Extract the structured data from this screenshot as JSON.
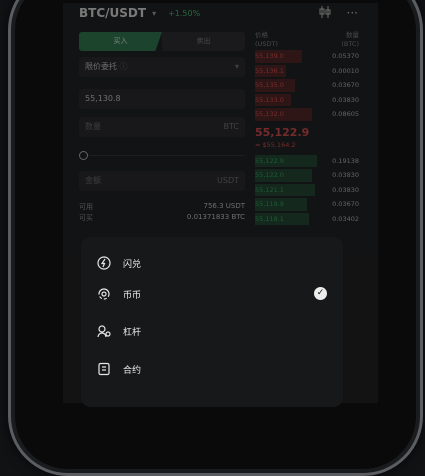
{
  "header": {
    "pair": "BTC/USDT",
    "caret": "▾",
    "change": "+1.50%",
    "icons": [
      "candlestick-icon",
      "more-icon"
    ]
  },
  "tabs": {
    "buy": "买入",
    "sell": "卖出"
  },
  "order_type": {
    "value": "限价委托",
    "hint": "ⓘ",
    "caret": "▾"
  },
  "price_input": {
    "value": "55,130.8"
  },
  "amount_input": {
    "placeholder": "数量",
    "unit": "BTC"
  },
  "total_input": {
    "placeholder": "金额",
    "unit": "USDT"
  },
  "balances": {
    "available_label": "可用",
    "available_value": "756.3 USDT",
    "buyable_label": "可买",
    "buyable_value": "0.01371833 BTC"
  },
  "orderbook": {
    "price_header": [
      "价格",
      "(USDT)"
    ],
    "qty_header": [
      "数量",
      "(BTC)"
    ],
    "asks": [
      {
        "price": "55,139.0",
        "qty": "0.05370",
        "depth": 0.45
      },
      {
        "price": "55,136.1",
        "qty": "0.00010",
        "depth": 0.3
      },
      {
        "price": "55,135.0",
        "qty": "0.03670",
        "depth": 0.38
      },
      {
        "price": "55,133.0",
        "qty": "0.03830",
        "depth": 0.35
      },
      {
        "price": "55,132.0",
        "qty": "0.08605",
        "depth": 0.55
      }
    ],
    "mid_price": "55,122.9",
    "mid_usd": "≈ $55,164.2",
    "bids": [
      {
        "price": "55,122.9",
        "qty": "0.19138",
        "depth": 0.6
      },
      {
        "price": "55,122.0",
        "qty": "0.03830",
        "depth": 0.55
      },
      {
        "price": "55,121.1",
        "qty": "0.03830",
        "depth": 0.58
      },
      {
        "price": "55,119.9",
        "qty": "0.03670",
        "depth": 0.5
      },
      {
        "price": "55,118.1",
        "qty": "0.03402",
        "depth": 0.52
      }
    ]
  },
  "sheet": {
    "items": [
      {
        "label": "闪兑",
        "icon": "flash-swap-icon",
        "selected": false
      },
      {
        "label": "币币",
        "icon": "spot-icon",
        "selected": true
      },
      {
        "label": "杠杆",
        "icon": "margin-icon",
        "selected": false
      },
      {
        "label": "合约",
        "icon": "futures-icon",
        "selected": false
      }
    ],
    "check": "✓"
  }
}
